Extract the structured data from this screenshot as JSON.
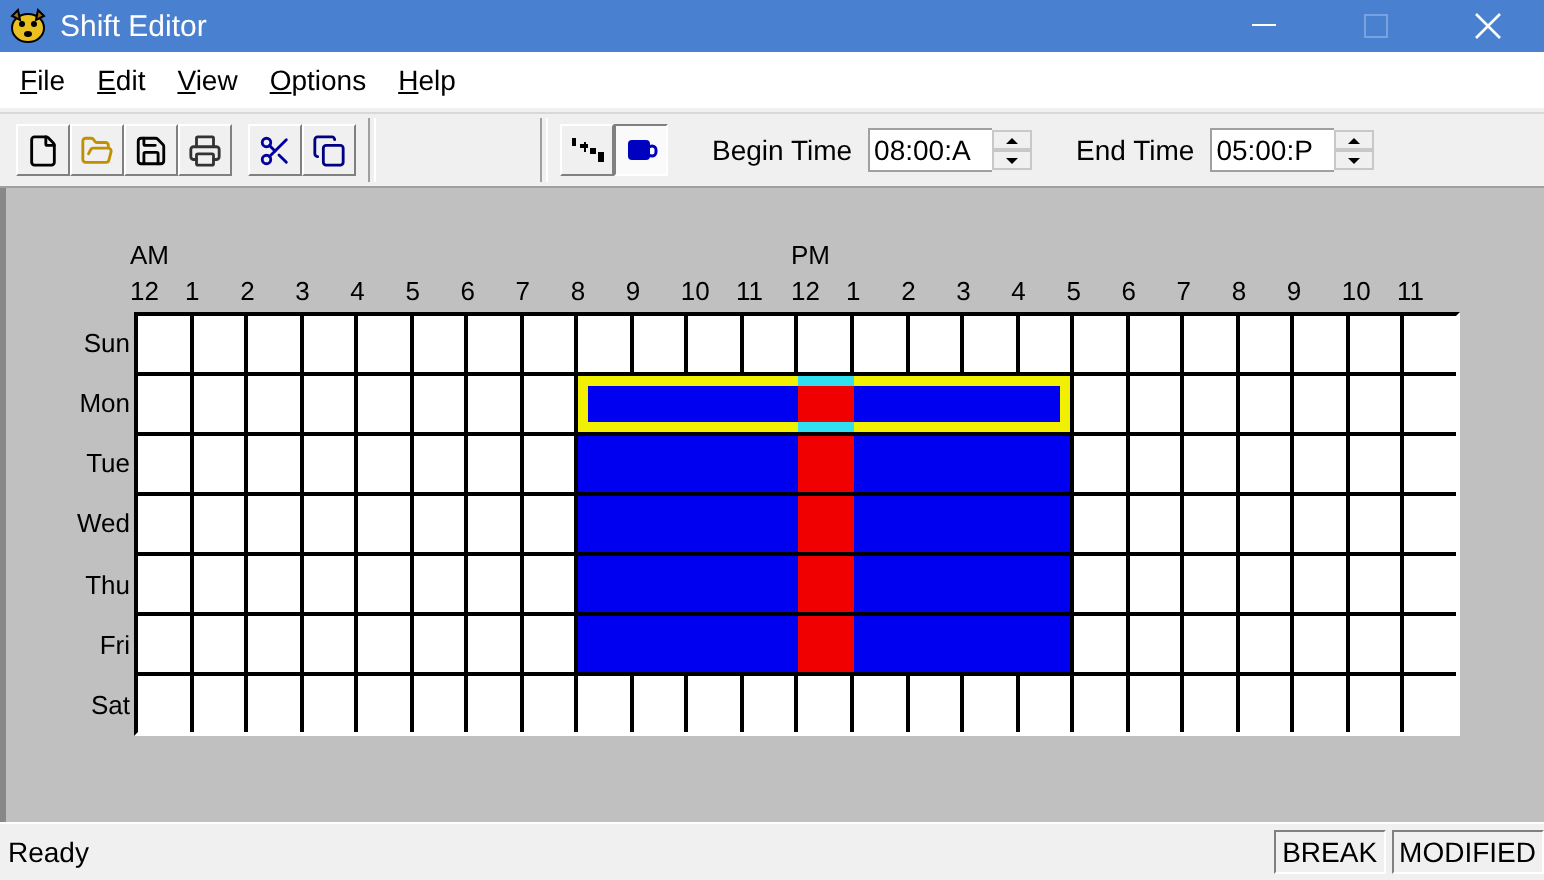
{
  "window": {
    "title": "Shift Editor"
  },
  "menu": [
    "File",
    "Edit",
    "View",
    "Options",
    "Help"
  ],
  "toggles": [
    {
      "kind": "nine-to-five",
      "pressed": false
    },
    {
      "kind": "break",
      "pressed": true
    }
  ],
  "begin_time": {
    "label": "Begin Time",
    "value": "08:00:A"
  },
  "end_time": {
    "label": "End Time",
    "value": "05:00:P"
  },
  "schedule": {
    "am_label": "AM",
    "pm_label": "PM",
    "hours": [
      "12",
      "1",
      "2",
      "3",
      "4",
      "5",
      "6",
      "7",
      "8",
      "9",
      "10",
      "11",
      "12",
      "1",
      "2",
      "3",
      "4",
      "5",
      "6",
      "7",
      "8",
      "9",
      "10",
      "11"
    ],
    "days": [
      {
        "label": "Sun",
        "cells": [
          {
            "kind": "off"
          },
          {
            "kind": "off"
          },
          {
            "kind": "off"
          },
          {
            "kind": "off"
          },
          {
            "kind": "off"
          },
          {
            "kind": "off"
          },
          {
            "kind": "off"
          },
          {
            "kind": "off"
          },
          {
            "kind": "off"
          },
          {
            "kind": "off"
          },
          {
            "kind": "off"
          },
          {
            "kind": "off"
          },
          {
            "kind": "off"
          },
          {
            "kind": "off"
          },
          {
            "kind": "off"
          },
          {
            "kind": "off"
          },
          {
            "kind": "off"
          },
          {
            "kind": "off"
          },
          {
            "kind": "off"
          },
          {
            "kind": "off"
          },
          {
            "kind": "off"
          },
          {
            "kind": "off"
          },
          {
            "kind": "off"
          },
          {
            "kind": "off"
          }
        ]
      },
      {
        "label": "Mon",
        "selected": true,
        "cells": [
          {
            "kind": "off"
          },
          {
            "kind": "off"
          },
          {
            "kind": "off"
          },
          {
            "kind": "off"
          },
          {
            "kind": "off"
          },
          {
            "kind": "off"
          },
          {
            "kind": "off"
          },
          {
            "kind": "off"
          },
          {
            "kind": "work"
          },
          {
            "kind": "work"
          },
          {
            "kind": "work"
          },
          {
            "kind": "work"
          },
          {
            "kind": "break"
          },
          {
            "kind": "work"
          },
          {
            "kind": "work"
          },
          {
            "kind": "work"
          },
          {
            "kind": "work"
          },
          {
            "kind": "off"
          },
          {
            "kind": "off"
          },
          {
            "kind": "off"
          },
          {
            "kind": "off"
          },
          {
            "kind": "off"
          },
          {
            "kind": "off"
          },
          {
            "kind": "off"
          }
        ]
      },
      {
        "label": "Tue",
        "selected": false,
        "cells": [
          {
            "kind": "off"
          },
          {
            "kind": "off"
          },
          {
            "kind": "off"
          },
          {
            "kind": "off"
          },
          {
            "kind": "off"
          },
          {
            "kind": "off"
          },
          {
            "kind": "off"
          },
          {
            "kind": "off"
          },
          {
            "kind": "work"
          },
          {
            "kind": "work"
          },
          {
            "kind": "work"
          },
          {
            "kind": "work"
          },
          {
            "kind": "break"
          },
          {
            "kind": "work"
          },
          {
            "kind": "work"
          },
          {
            "kind": "work"
          },
          {
            "kind": "work"
          },
          {
            "kind": "off"
          },
          {
            "kind": "off"
          },
          {
            "kind": "off"
          },
          {
            "kind": "off"
          },
          {
            "kind": "off"
          },
          {
            "kind": "off"
          },
          {
            "kind": "off"
          }
        ]
      },
      {
        "label": "Wed",
        "selected": false,
        "cells": [
          {
            "kind": "off"
          },
          {
            "kind": "off"
          },
          {
            "kind": "off"
          },
          {
            "kind": "off"
          },
          {
            "kind": "off"
          },
          {
            "kind": "off"
          },
          {
            "kind": "off"
          },
          {
            "kind": "off"
          },
          {
            "kind": "work"
          },
          {
            "kind": "work"
          },
          {
            "kind": "work"
          },
          {
            "kind": "work"
          },
          {
            "kind": "break"
          },
          {
            "kind": "work"
          },
          {
            "kind": "work"
          },
          {
            "kind": "work"
          },
          {
            "kind": "work"
          },
          {
            "kind": "off"
          },
          {
            "kind": "off"
          },
          {
            "kind": "off"
          },
          {
            "kind": "off"
          },
          {
            "kind": "off"
          },
          {
            "kind": "off"
          },
          {
            "kind": "off"
          }
        ]
      },
      {
        "label": "Thu",
        "selected": false,
        "cells": [
          {
            "kind": "off"
          },
          {
            "kind": "off"
          },
          {
            "kind": "off"
          },
          {
            "kind": "off"
          },
          {
            "kind": "off"
          },
          {
            "kind": "off"
          },
          {
            "kind": "off"
          },
          {
            "kind": "off"
          },
          {
            "kind": "work"
          },
          {
            "kind": "work"
          },
          {
            "kind": "work"
          },
          {
            "kind": "work"
          },
          {
            "kind": "break"
          },
          {
            "kind": "work"
          },
          {
            "kind": "work"
          },
          {
            "kind": "work"
          },
          {
            "kind": "work"
          },
          {
            "kind": "off"
          },
          {
            "kind": "off"
          },
          {
            "kind": "off"
          },
          {
            "kind": "off"
          },
          {
            "kind": "off"
          },
          {
            "kind": "off"
          },
          {
            "kind": "off"
          }
        ]
      },
      {
        "label": "Fri",
        "selected": false,
        "cells": [
          {
            "kind": "off"
          },
          {
            "kind": "off"
          },
          {
            "kind": "off"
          },
          {
            "kind": "off"
          },
          {
            "kind": "off"
          },
          {
            "kind": "off"
          },
          {
            "kind": "off"
          },
          {
            "kind": "off"
          },
          {
            "kind": "work"
          },
          {
            "kind": "work"
          },
          {
            "kind": "work"
          },
          {
            "kind": "work"
          },
          {
            "kind": "break"
          },
          {
            "kind": "work"
          },
          {
            "kind": "work"
          },
          {
            "kind": "work"
          },
          {
            "kind": "work"
          },
          {
            "kind": "off"
          },
          {
            "kind": "off"
          },
          {
            "kind": "off"
          },
          {
            "kind": "off"
          },
          {
            "kind": "off"
          },
          {
            "kind": "off"
          },
          {
            "kind": "off"
          }
        ]
      },
      {
        "label": "Sat",
        "cells": [
          {
            "kind": "off"
          },
          {
            "kind": "off"
          },
          {
            "kind": "off"
          },
          {
            "kind": "off"
          },
          {
            "kind": "off"
          },
          {
            "kind": "off"
          },
          {
            "kind": "off"
          },
          {
            "kind": "off"
          },
          {
            "kind": "off"
          },
          {
            "kind": "off"
          },
          {
            "kind": "off"
          },
          {
            "kind": "off"
          },
          {
            "kind": "off"
          },
          {
            "kind": "off"
          },
          {
            "kind": "off"
          },
          {
            "kind": "off"
          },
          {
            "kind": "off"
          },
          {
            "kind": "off"
          },
          {
            "kind": "off"
          },
          {
            "kind": "off"
          },
          {
            "kind": "off"
          },
          {
            "kind": "off"
          },
          {
            "kind": "off"
          },
          {
            "kind": "off"
          }
        ]
      }
    ]
  },
  "status_bar": {
    "message": "Ready",
    "panels": [
      "BREAK",
      "MODIFIED"
    ]
  }
}
